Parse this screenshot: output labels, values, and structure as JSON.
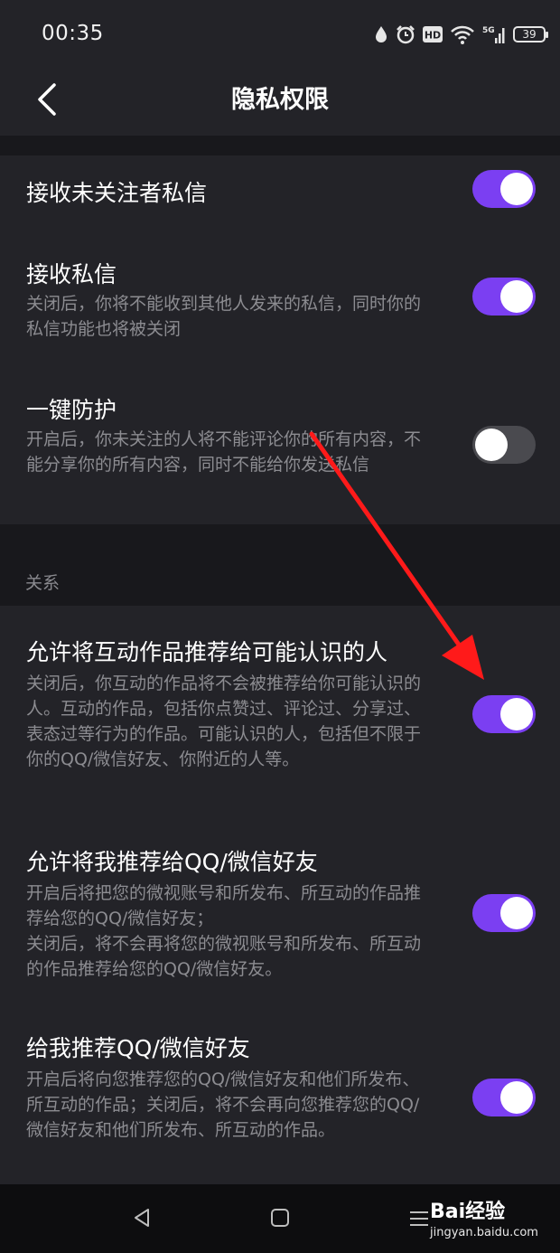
{
  "status_bar": {
    "time": "00:35",
    "hd_badge": "HD",
    "network": "5G",
    "battery": "39",
    "icons": [
      "water-drop-icon",
      "alarm-icon",
      "hd-icon",
      "wifi-icon",
      "signal-5g-icon",
      "battery-icon"
    ]
  },
  "header": {
    "title": "隐私权限",
    "back_icon": "chevron-left-icon"
  },
  "settings": {
    "receive_stranger_dm": {
      "title": "接收未关注者私信",
      "enabled": true
    },
    "receive_dm": {
      "title": "接收私信",
      "desc": "关闭后，你将不能收到其他人发来的私信，同时你的私信功能也将被关闭",
      "enabled": true
    },
    "one_key_protect": {
      "title": "一键防护",
      "desc": "开启后，你未关注的人将不能评论你的所有内容，不能分享你的所有内容，同时不能给你发送私信",
      "enabled": false
    }
  },
  "relations": {
    "section_label": "关系",
    "recommend_interaction": {
      "title": "允许将互动作品推荐给可能认识的人",
      "desc": "关闭后，你互动的作品将不会被推荐给你可能认识的人。互动的作品，包括你点赞过、评论过、分享过、表态过等行为的作品。可能认识的人，包括但不限于你的QQ/微信好友、你附近的人等。",
      "enabled": true
    },
    "recommend_me": {
      "title": "允许将我推荐给QQ/微信好友",
      "desc_line1": "开启后将把您的微视账号和所发布、所互动的作品推荐给您的QQ/微信好友；",
      "desc_line2": "关闭后，将不会再将您的微视账号和所发布、所互动的作品推荐给您的QQ/微信好友。",
      "enabled": true
    },
    "recommend_friends": {
      "title": "给我推荐QQ/微信好友",
      "desc": "开启后将向您推荐您的QQ/微信好友和他们所发布、所互动的作品；关闭后，将不会再向您推荐您的QQ/微信好友和他们所发布、所互动的作品。",
      "enabled": true
    }
  },
  "nav_bar": {
    "icons": [
      "nav-back-icon",
      "nav-home-icon",
      "nav-menu-icon"
    ]
  },
  "watermark": {
    "brand": "Bai经验",
    "url": "jingyan.baidu.com"
  },
  "colors": {
    "accent": "#7b3ff2",
    "background": "#18181c",
    "panel": "#232328",
    "annotation_arrow": "#ff1a1a"
  }
}
